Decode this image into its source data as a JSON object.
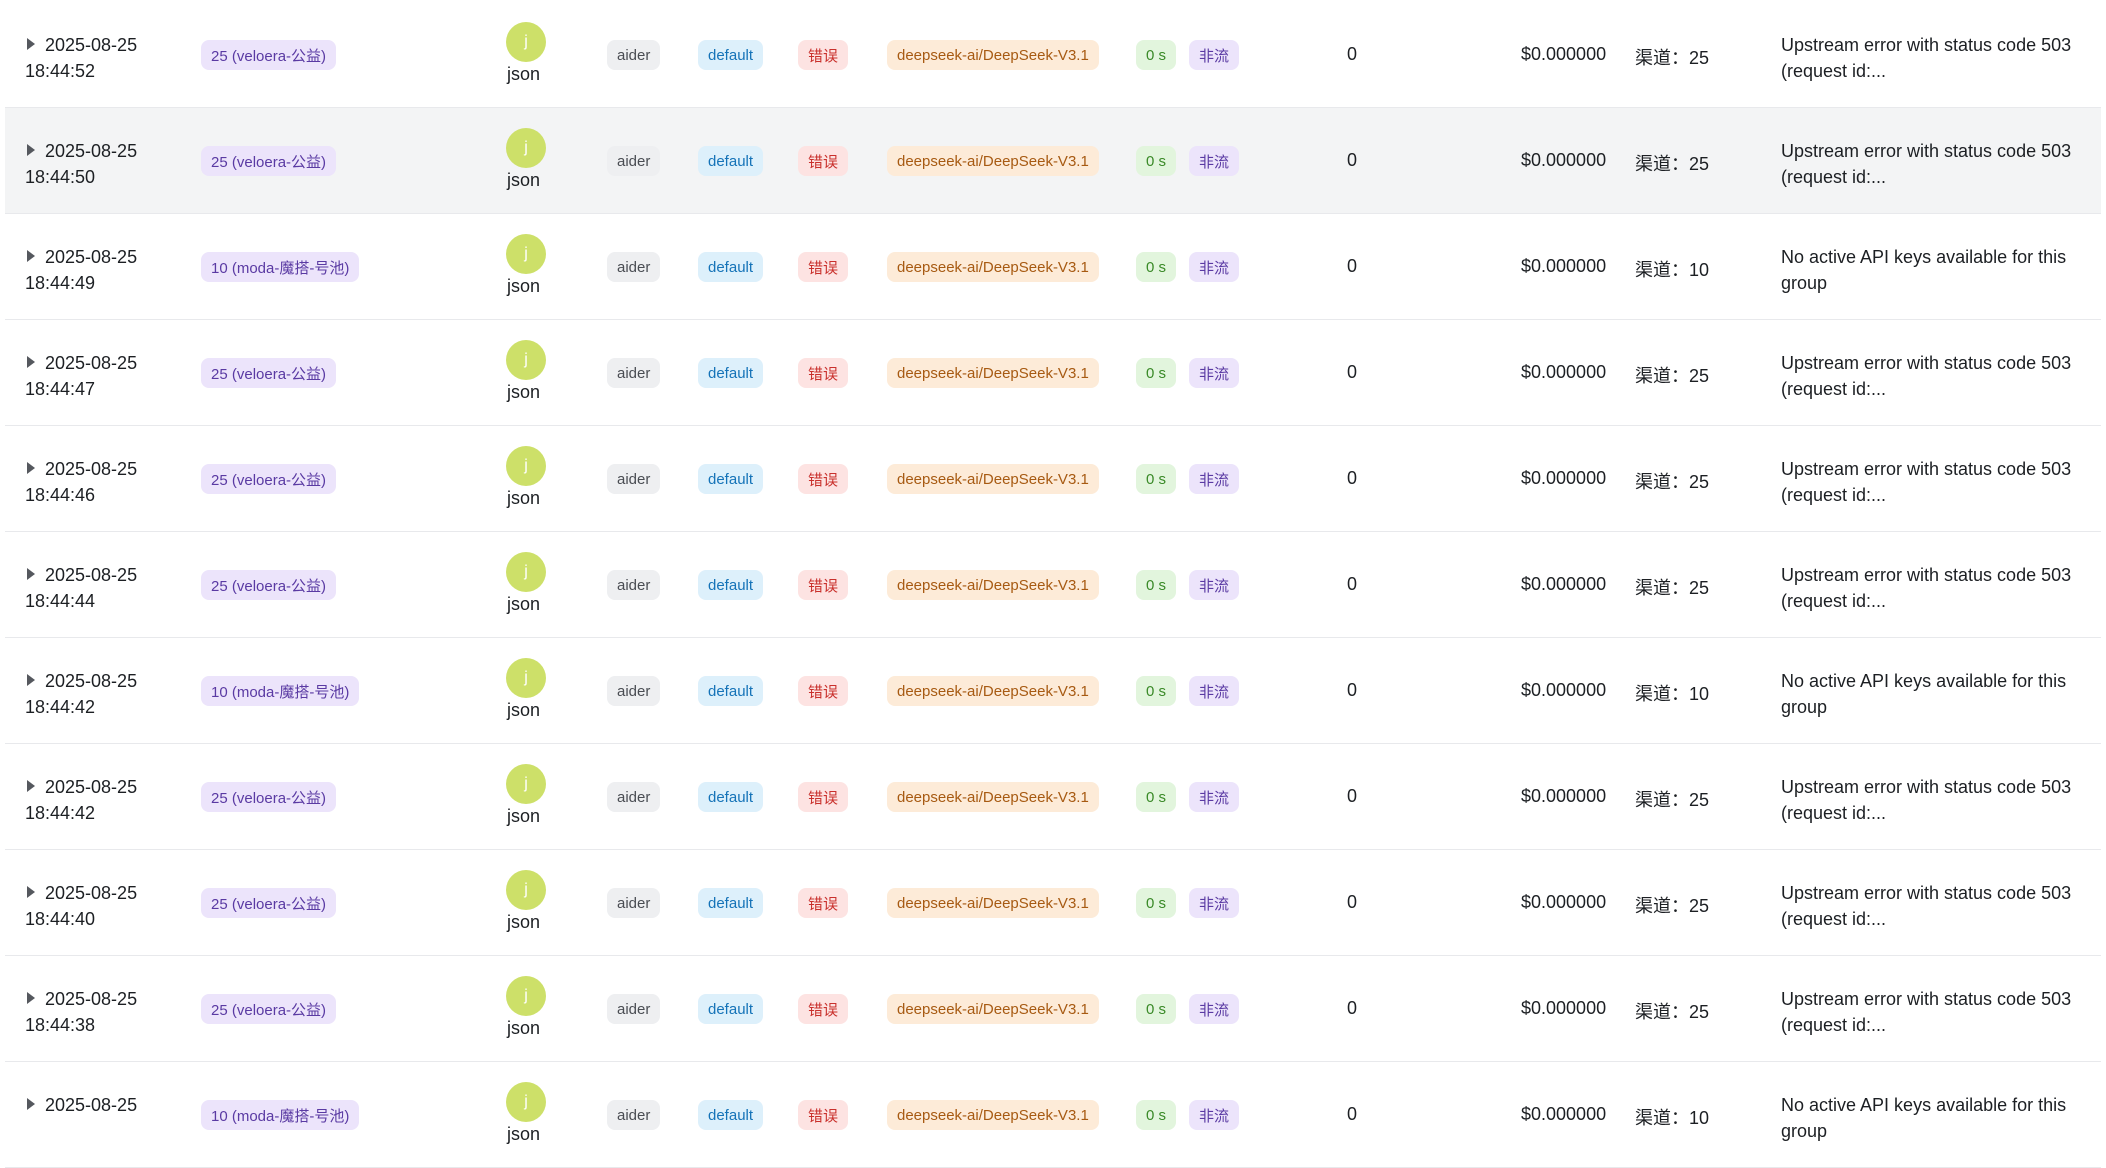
{
  "rows": [
    {
      "date": "2025-08-25",
      "time": "18:44:52",
      "channel": "25 (veloera-公益)",
      "user_initial": "j",
      "user": "json",
      "token": "aider",
      "group": "default",
      "status": "错误",
      "model": "deepseek-ai/DeepSeek-V3.1",
      "use_time": "0 s",
      "stream": "非流",
      "tokens": "0",
      "cost": "$0.000000",
      "channel_label": "渠道：25",
      "message": "Upstream error with status code 503 (request id:..."
    },
    {
      "date": "2025-08-25",
      "time": "18:44:50",
      "channel": "25 (veloera-公益)",
      "user_initial": "j",
      "user": "json",
      "token": "aider",
      "group": "default",
      "status": "错误",
      "model": "deepseek-ai/DeepSeek-V3.1",
      "use_time": "0 s",
      "stream": "非流",
      "tokens": "0",
      "cost": "$0.000000",
      "channel_label": "渠道：25",
      "message": "Upstream error with status code 503 (request id:..."
    },
    {
      "date": "2025-08-25",
      "time": "18:44:49",
      "channel": "10 (moda-魔搭-号池)",
      "user_initial": "j",
      "user": "json",
      "token": "aider",
      "group": "default",
      "status": "错误",
      "model": "deepseek-ai/DeepSeek-V3.1",
      "use_time": "0 s",
      "stream": "非流",
      "tokens": "0",
      "cost": "$0.000000",
      "channel_label": "渠道：10",
      "message": "No active API keys available for this group"
    },
    {
      "date": "2025-08-25",
      "time": "18:44:47",
      "channel": "25 (veloera-公益)",
      "user_initial": "j",
      "user": "json",
      "token": "aider",
      "group": "default",
      "status": "错误",
      "model": "deepseek-ai/DeepSeek-V3.1",
      "use_time": "0 s",
      "stream": "非流",
      "tokens": "0",
      "cost": "$0.000000",
      "channel_label": "渠道：25",
      "message": "Upstream error with status code 503 (request id:..."
    },
    {
      "date": "2025-08-25",
      "time": "18:44:46",
      "channel": "25 (veloera-公益)",
      "user_initial": "j",
      "user": "json",
      "token": "aider",
      "group": "default",
      "status": "错误",
      "model": "deepseek-ai/DeepSeek-V3.1",
      "use_time": "0 s",
      "stream": "非流",
      "tokens": "0",
      "cost": "$0.000000",
      "channel_label": "渠道：25",
      "message": "Upstream error with status code 503 (request id:..."
    },
    {
      "date": "2025-08-25",
      "time": "18:44:44",
      "channel": "25 (veloera-公益)",
      "user_initial": "j",
      "user": "json",
      "token": "aider",
      "group": "default",
      "status": "错误",
      "model": "deepseek-ai/DeepSeek-V3.1",
      "use_time": "0 s",
      "stream": "非流",
      "tokens": "0",
      "cost": "$0.000000",
      "channel_label": "渠道：25",
      "message": "Upstream error with status code 503 (request id:..."
    },
    {
      "date": "2025-08-25",
      "time": "18:44:42",
      "channel": "10 (moda-魔搭-号池)",
      "user_initial": "j",
      "user": "json",
      "token": "aider",
      "group": "default",
      "status": "错误",
      "model": "deepseek-ai/DeepSeek-V3.1",
      "use_time": "0 s",
      "stream": "非流",
      "tokens": "0",
      "cost": "$0.000000",
      "channel_label": "渠道：10",
      "message": "No active API keys available for this group"
    },
    {
      "date": "2025-08-25",
      "time": "18:44:42",
      "channel": "25 (veloera-公益)",
      "user_initial": "j",
      "user": "json",
      "token": "aider",
      "group": "default",
      "status": "错误",
      "model": "deepseek-ai/DeepSeek-V3.1",
      "use_time": "0 s",
      "stream": "非流",
      "tokens": "0",
      "cost": "$0.000000",
      "channel_label": "渠道：25",
      "message": "Upstream error with status code 503 (request id:..."
    },
    {
      "date": "2025-08-25",
      "time": "18:44:40",
      "channel": "25 (veloera-公益)",
      "user_initial": "j",
      "user": "json",
      "token": "aider",
      "group": "default",
      "status": "错误",
      "model": "deepseek-ai/DeepSeek-V3.1",
      "use_time": "0 s",
      "stream": "非流",
      "tokens": "0",
      "cost": "$0.000000",
      "channel_label": "渠道：25",
      "message": "Upstream error with status code 503 (request id:..."
    },
    {
      "date": "2025-08-25",
      "time": "18:44:38",
      "channel": "25 (veloera-公益)",
      "user_initial": "j",
      "user": "json",
      "token": "aider",
      "group": "default",
      "status": "错误",
      "model": "deepseek-ai/DeepSeek-V3.1",
      "use_time": "0 s",
      "stream": "非流",
      "tokens": "0",
      "cost": "$0.000000",
      "channel_label": "渠道：25",
      "message": "Upstream error with status code 503 (request id:..."
    },
    {
      "date": "2025-08-25",
      "time": "",
      "channel": "10 (moda-魔搭-号池)",
      "user_initial": "j",
      "user": "json",
      "token": "aider",
      "group": "default",
      "status": "错误",
      "model": "deepseek-ai/DeepSeek-V3.1",
      "use_time": "0 s",
      "stream": "非流",
      "tokens": "0",
      "cost": "$0.000000",
      "channel_label": "渠道：10",
      "message": "No active API keys available for this group"
    }
  ],
  "hover_row_index": 1,
  "icons": {
    "expand": "caret-right-icon"
  }
}
